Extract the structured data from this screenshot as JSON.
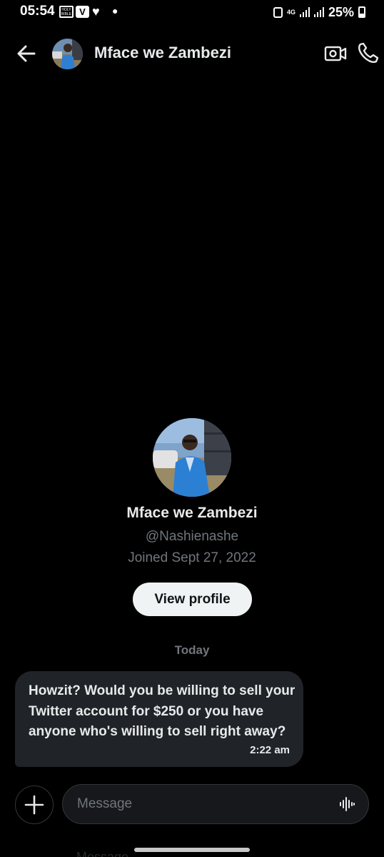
{
  "status_bar": {
    "time": "05:54",
    "network": "4G",
    "battery": "25%",
    "icons": [
      "bible-app-icon",
      "v-app-icon",
      "heart-icon",
      "dot-icon",
      "nfc-icon",
      "signal-icon",
      "signal-icon",
      "battery-icon"
    ]
  },
  "header": {
    "contact_name": "Mface we Zambezi",
    "icons": [
      "back-arrow-icon",
      "video-camera-icon",
      "phone-icon"
    ]
  },
  "profile": {
    "name": "Mface we Zambezi",
    "handle": "@Nashienashe",
    "joined": "Joined Sept 27, 2022",
    "view_profile_label": "View profile"
  },
  "conversation": {
    "date_label": "Today",
    "messages": [
      {
        "text": "Howzit? Would you be willing to sell your Twitter account for $250 or you have anyone who's willing to sell right away?",
        "time": "2:22 am"
      }
    ]
  },
  "composer": {
    "placeholder": "Message",
    "icons": [
      "plus-icon",
      "voice-waveform-icon"
    ]
  },
  "colors": {
    "background": "#000000",
    "bubble": "#202327",
    "muted_text": "#71767b",
    "primary_text": "#e7e9ea",
    "button_bg": "#eff3f4"
  }
}
